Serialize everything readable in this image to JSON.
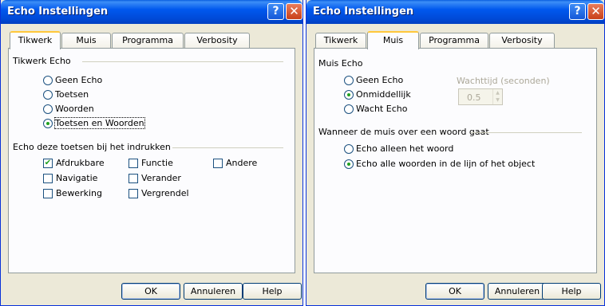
{
  "left": {
    "title": "Echo Instellingen",
    "tabs": [
      "Tikwerk",
      "Muis",
      "Programma",
      "Verbosity"
    ],
    "echo_group": "Tikwerk Echo",
    "echo_options": [
      "Geen Echo",
      "Toetsen",
      "Woorden",
      "Toetsen en Woorden"
    ],
    "echo_selected": "Toetsen en Woorden",
    "keys_group": "Echo deze toetsen bij het indrukken",
    "keys": [
      {
        "label": "Afdrukbare",
        "checked": true
      },
      {
        "label": "Navigatie",
        "checked": false
      },
      {
        "label": "Bewerking",
        "checked": false
      },
      {
        "label": "Functie",
        "checked": false
      },
      {
        "label": "Verander",
        "checked": false
      },
      {
        "label": "Vergrendel",
        "checked": false
      },
      {
        "label": "Andere",
        "checked": false
      }
    ],
    "buttons": {
      "ok": "OK",
      "cancel": "Annuleren",
      "help": "Help"
    }
  },
  "right": {
    "title": "Echo Instellingen",
    "tabs": [
      "Tikwerk",
      "Muis",
      "Programma",
      "Verbosity"
    ],
    "mouse_group": "Muis Echo",
    "mouse_options": [
      "Geen Echo",
      "Onmiddellijk",
      "Wacht Echo"
    ],
    "mouse_selected": "Onmiddellijk",
    "wait_label": "Wachttijd (seconden)",
    "wait_value": "0.5",
    "hover_group": "Wanneer de muis over een woord gaat",
    "hover_options": [
      "Echo alleen het woord",
      "Echo alle woorden in de lijn of het object"
    ],
    "hover_selected": "Echo alle woorden in de lijn of het object",
    "buttons": {
      "ok": "OK",
      "cancel": "Annuleren",
      "help": "Help"
    }
  },
  "titlebar_buttons": {
    "help": "?",
    "close": "✕"
  },
  "colors": {
    "titlebar": "#0058ee",
    "dialog": "#ece9d8",
    "panel": "#fcfcfe",
    "tab_highlight": "#ffc83c"
  }
}
